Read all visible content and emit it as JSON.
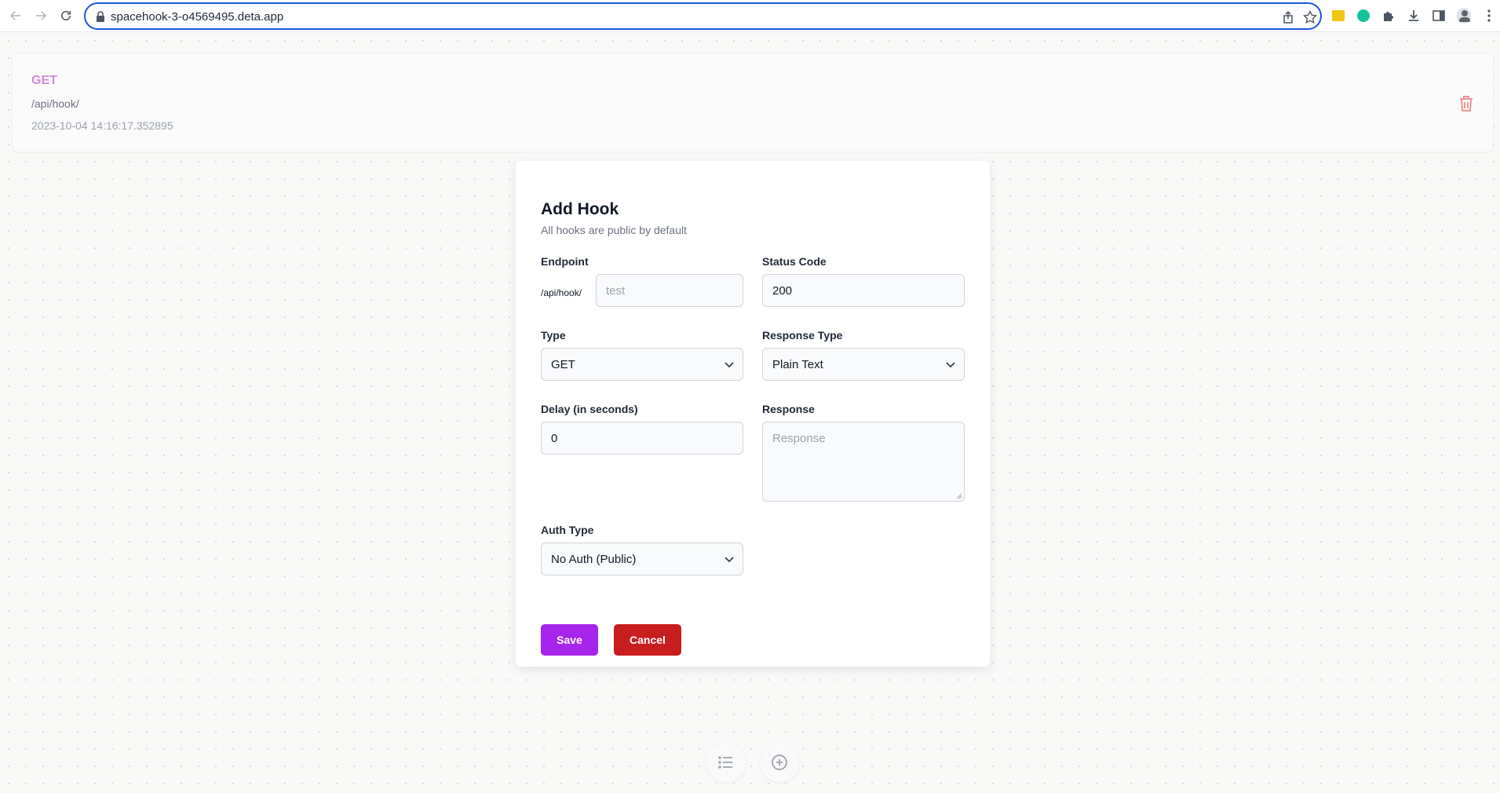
{
  "browser": {
    "url": "spacehook-3-o4569495.deta.app"
  },
  "hook": {
    "method": "GET",
    "path": "/api/hook/",
    "timestamp": "2023-10-04 14:16:17.352895",
    "method_color": "#d08ae0"
  },
  "modal": {
    "title": "Add Hook",
    "subtitle": "All hooks are public by default",
    "endpoint_label": "Endpoint",
    "endpoint_prefix": "/api/hook/",
    "endpoint_placeholder": "test",
    "status_label": "Status Code",
    "status_value": "200",
    "type_label": "Type",
    "type_value": "GET",
    "response_type_label": "Response Type",
    "response_type_value": "Plain Text",
    "delay_label": "Delay (in seconds)",
    "delay_value": "0",
    "response_label": "Response",
    "response_placeholder": "Response",
    "auth_label": "Auth Type",
    "auth_value": "No Auth (Public)",
    "save_label": "Save",
    "cancel_label": "Cancel",
    "save_color": "#a525ec",
    "cancel_color": "#c81e1e"
  },
  "icons": {
    "back": "arrow-left-icon",
    "forward": "arrow-right-icon",
    "reload": "reload-icon",
    "lock": "lock-icon",
    "share": "share-icon",
    "bookmark": "star-icon",
    "trash": "trash-icon",
    "list": "list-icon",
    "add": "plus-circle-icon"
  }
}
